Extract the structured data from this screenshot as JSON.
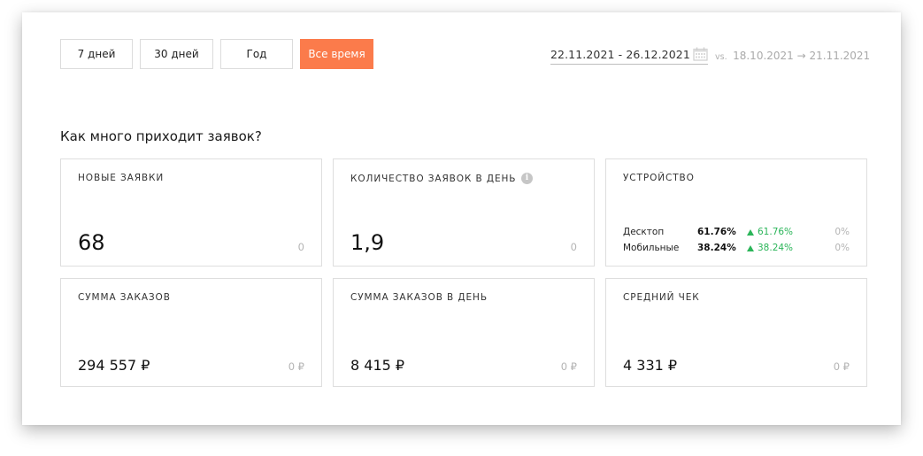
{
  "periods": [
    {
      "label": "7 дней",
      "active": false
    },
    {
      "label": "30 дней",
      "active": false
    },
    {
      "label": "Год",
      "active": false
    },
    {
      "label": "Все время",
      "active": true
    }
  ],
  "daterange": {
    "value": "22.11.2021 - 26.12.2021",
    "compare_prefix": "vs.",
    "compare_range": "18.10.2021 → 21.11.2021"
  },
  "section_title": "Как много приходит заявок?",
  "tiles": {
    "new_requests": {
      "title": "НОВЫЕ ЗАЯВКИ",
      "value": "68",
      "compare": "0"
    },
    "requests_per_day": {
      "title": "КОЛИЧЕСТВО ЗАЯВОК В ДЕНЬ",
      "value": "1,9",
      "compare": "0"
    },
    "device": {
      "title": "УСТРОЙСТВО",
      "rows": [
        {
          "name": "Десктоп",
          "pct": "61.76%",
          "delta": "61.76%",
          "change": "0%"
        },
        {
          "name": "Мобильные",
          "pct": "38.24%",
          "delta": "38.24%",
          "change": "0%"
        }
      ]
    },
    "orders_sum": {
      "title": "СУММА ЗАКАЗОВ",
      "value": "294 557 ₽",
      "compare": "0 ₽"
    },
    "orders_sum_per_day": {
      "title": "СУММА ЗАКАЗОВ В ДЕНЬ",
      "value": "8 415 ₽",
      "compare": "0 ₽"
    },
    "avg_check": {
      "title": "СРЕДНИЙ ЧЕК",
      "value": "4 331 ₽",
      "compare": "0 ₽"
    }
  },
  "colors": {
    "accent": "#fb7b4b",
    "positive": "#2bb559",
    "muted": "#b4b4b4"
  }
}
